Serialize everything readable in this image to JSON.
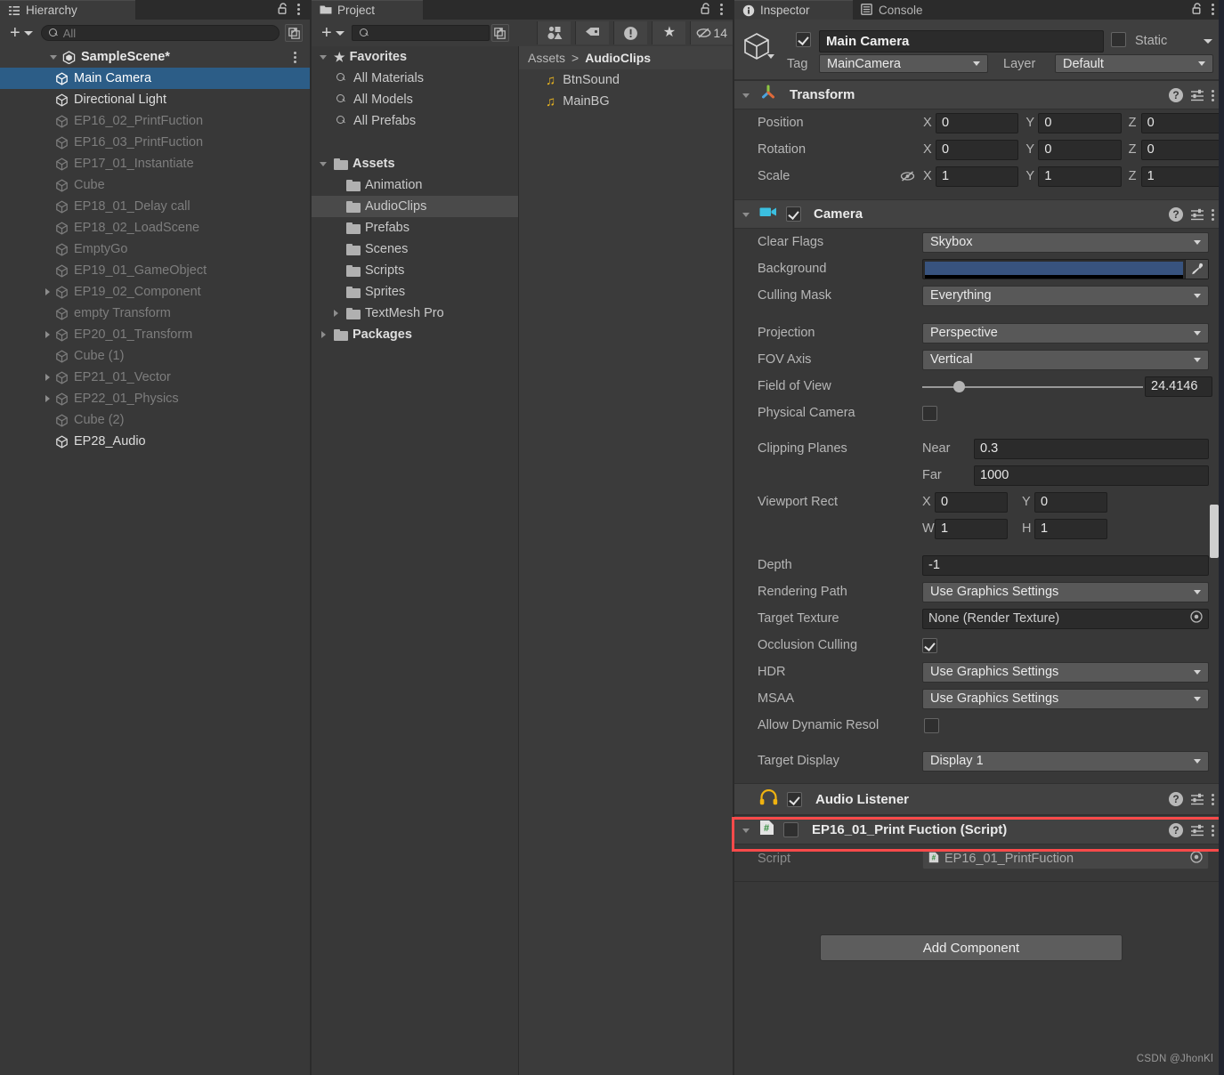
{
  "hierarchy": {
    "tab_label": "Hierarchy",
    "tab_icon": "hierarchy-icon",
    "toolbar": {
      "add_label": "+",
      "search_placeholder": "All",
      "search_value": ""
    },
    "scene": {
      "name": "SampleScene*",
      "expanded": true
    },
    "items": [
      {
        "label": "Main Camera",
        "state": "selected",
        "expandable": false
      },
      {
        "label": "Directional Light",
        "state": "normal",
        "expandable": false
      },
      {
        "label": "EP16_02_PrintFuction",
        "state": "inactive",
        "expandable": false
      },
      {
        "label": "EP16_03_PrintFuction",
        "state": "inactive",
        "expandable": false
      },
      {
        "label": "EP17_01_Instantiate",
        "state": "inactive",
        "expandable": false
      },
      {
        "label": "Cube",
        "state": "inactive",
        "expandable": false
      },
      {
        "label": "EP18_01_Delay call",
        "state": "inactive",
        "expandable": false
      },
      {
        "label": "EP18_02_LoadScene",
        "state": "inactive",
        "expandable": false
      },
      {
        "label": "EmptyGo",
        "state": "inactive",
        "expandable": false
      },
      {
        "label": "EP19_01_GameObject",
        "state": "inactive",
        "expandable": false
      },
      {
        "label": "EP19_02_Component",
        "state": "inactive",
        "expandable": true
      },
      {
        "label": "empty Transform",
        "state": "inactive",
        "expandable": false
      },
      {
        "label": "EP20_01_Transform",
        "state": "inactive",
        "expandable": true
      },
      {
        "label": "Cube (1)",
        "state": "inactive",
        "expandable": false
      },
      {
        "label": "EP21_01_Vector",
        "state": "inactive",
        "expandable": true
      },
      {
        "label": "EP22_01_Physics",
        "state": "inactive",
        "expandable": true
      },
      {
        "label": "Cube (2)",
        "state": "inactive",
        "expandable": false
      },
      {
        "label": "EP28_Audio",
        "state": "normal",
        "expandable": false
      }
    ]
  },
  "project": {
    "tab_label": "Project",
    "tab_icon": "folder-icon",
    "toolbar": {
      "add_label": "+",
      "search_placeholder": "",
      "filters": [
        {
          "name": "asset-type-filter-icon",
          "label": ""
        },
        {
          "name": "label-filter-icon",
          "label": ""
        },
        {
          "name": "warning-filter-icon",
          "label": ""
        },
        {
          "name": "favorite-filter-icon",
          "label": ""
        },
        {
          "name": "hidden-count-icon",
          "label": "14"
        }
      ]
    },
    "tree": {
      "favorites": {
        "label": "Favorites",
        "expanded": true,
        "items": [
          "All Materials",
          "All Models",
          "All Prefabs"
        ]
      },
      "assets": {
        "label": "Assets",
        "expanded": true,
        "folders": [
          {
            "label": "Animation",
            "selected": false,
            "expandable": false
          },
          {
            "label": "AudioClips",
            "selected": true,
            "expandable": false
          },
          {
            "label": "Prefabs",
            "selected": false,
            "expandable": false
          },
          {
            "label": "Scenes",
            "selected": false,
            "expandable": false
          },
          {
            "label": "Scripts",
            "selected": false,
            "expandable": false
          },
          {
            "label": "Sprites",
            "selected": false,
            "expandable": false
          },
          {
            "label": "TextMesh Pro",
            "selected": false,
            "expandable": true
          }
        ]
      },
      "packages": {
        "label": "Packages",
        "expanded": false
      }
    },
    "breadcrumb": {
      "root": "Assets",
      "separator": ">",
      "current": "AudioClips"
    },
    "files": [
      {
        "label": "BtnSound",
        "icon": "audio-clip-icon"
      },
      {
        "label": "MainBG",
        "icon": "audio-clip-icon"
      }
    ]
  },
  "inspector": {
    "tabs": [
      {
        "label": "Inspector",
        "icon": "info-icon",
        "active": true
      },
      {
        "label": "Console",
        "icon": "console-icon",
        "active": false
      }
    ],
    "object": {
      "enabled": true,
      "name": "Main Camera",
      "static_label": "Static",
      "static_checked": false,
      "tag_label": "Tag",
      "tag_value": "MainCamera",
      "layer_label": "Layer",
      "layer_value": "Default"
    },
    "transform": {
      "title": "Transform",
      "expanded": true,
      "rows": [
        {
          "label": "Position",
          "x": "0",
          "y": "0",
          "z": "0"
        },
        {
          "label": "Rotation",
          "x": "0",
          "y": "0",
          "z": "0"
        },
        {
          "label": "Scale",
          "x": "1",
          "y": "1",
          "z": "1"
        }
      ],
      "axis_labels": {
        "x": "X",
        "y": "Y",
        "z": "Z"
      },
      "scale_lock_icon": "constrained-proportions-off-icon"
    },
    "camera": {
      "title": "Camera",
      "expanded": true,
      "enabled": true,
      "clear_flags_label": "Clear Flags",
      "clear_flags_value": "Skybox",
      "background_label": "Background",
      "background_color": "#38537e",
      "culling_mask_label": "Culling Mask",
      "culling_mask_value": "Everything",
      "projection_label": "Projection",
      "projection_value": "Perspective",
      "fov_axis_label": "FOV Axis",
      "fov_axis_value": "Vertical",
      "field_of_view_label": "Field of View",
      "field_of_view_value": "24.4146",
      "field_of_view_slider_pct": 14,
      "physical_camera_label": "Physical Camera",
      "physical_camera_checked": false,
      "clipping_planes_label": "Clipping Planes",
      "near_label": "Near",
      "near_value": "0.3",
      "far_label": "Far",
      "far_value": "1000",
      "viewport_rect_label": "Viewport Rect",
      "viewport": {
        "x_label": "X",
        "x": "0",
        "y_label": "Y",
        "y": "0",
        "w_label": "W",
        "w": "1",
        "h_label": "H",
        "h": "1"
      },
      "depth_label": "Depth",
      "depth_value": "-1",
      "rendering_path_label": "Rendering Path",
      "rendering_path_value": "Use Graphics Settings",
      "target_texture_label": "Target Texture",
      "target_texture_value": "None (Render Texture)",
      "occlusion_culling_label": "Occlusion Culling",
      "occlusion_culling_checked": true,
      "hdr_label": "HDR",
      "hdr_value": "Use Graphics Settings",
      "msaa_label": "MSAA",
      "msaa_value": "Use Graphics Settings",
      "allow_dynamic_label": "Allow Dynamic Resol",
      "allow_dynamic_checked": false,
      "target_display_label": "Target Display",
      "target_display_value": "Display 1"
    },
    "audio_listener": {
      "title": "Audio Listener",
      "enabled": true,
      "icon": "headphones-icon",
      "highlighted": true,
      "highlight_color": "#fb4a4a"
    },
    "script_component": {
      "title": "EP16_01_Print Fuction (Script)",
      "expanded": true,
      "enabled": false,
      "icon": "csharp-script-icon",
      "script_label": "Script",
      "script_value": "EP16_01_PrintFuction"
    },
    "add_component_label": "Add Component"
  },
  "watermark": "CSDN @JhonKl"
}
